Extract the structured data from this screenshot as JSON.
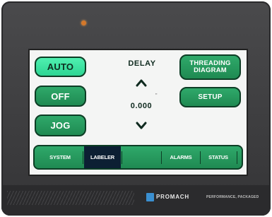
{
  "panel": {
    "buttons": {
      "auto": "AUTO",
      "off": "OFF",
      "jog": "JOG",
      "threading_line1": "THREADING",
      "threading_line2": "DIAGRAM",
      "setup": "SETUP"
    },
    "delay": {
      "label": "DELAY",
      "value": "0.000",
      "unit_mark": "\""
    },
    "nav": {
      "tabs": [
        {
          "label": "SYSTEM"
        },
        {
          "label": "LABELER"
        },
        {
          "label": ""
        },
        {
          "label": "ALARMS"
        },
        {
          "label": "STATUS"
        }
      ],
      "active": "LABELER"
    }
  },
  "footer": {
    "logo": "PROMACH",
    "tagline": "PERFORMANCE, PACKAGED"
  },
  "colors": {
    "button_green": "#1f8a52",
    "auto_active": "#3fe3a2",
    "active_tab": "#0c1f33",
    "bezel": "#3b3b3d",
    "led": "#d4782a",
    "logo_blue": "#3a8fd0"
  },
  "icons": {
    "increase": "chevron-up-icon",
    "decrease": "chevron-down-icon",
    "status_led": "led-indicator-icon"
  }
}
